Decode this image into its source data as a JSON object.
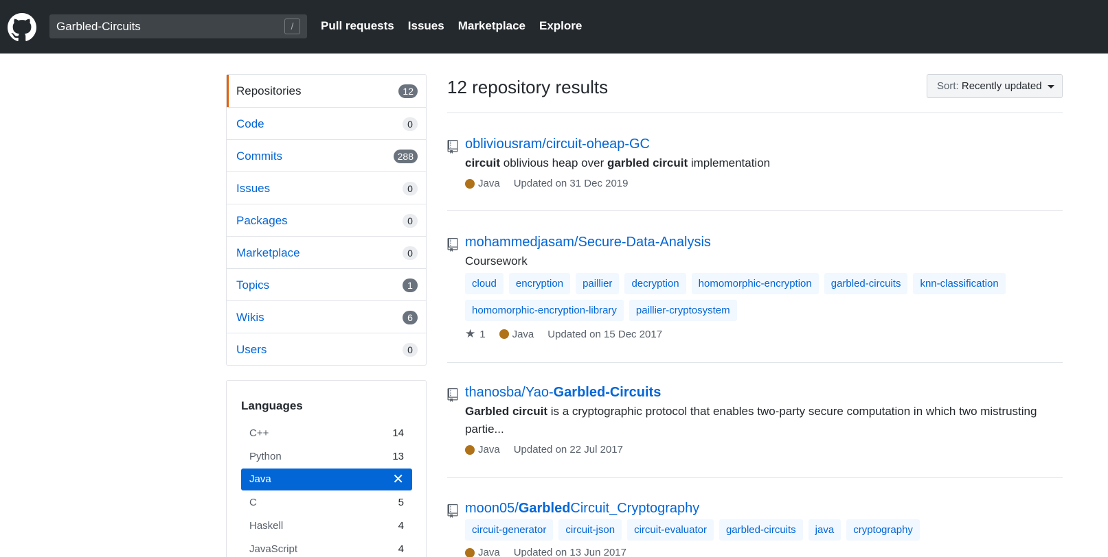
{
  "header": {
    "search_value": "Garbled-Circuits",
    "slash_key": "/",
    "nav": [
      "Pull requests",
      "Issues",
      "Marketplace",
      "Explore"
    ]
  },
  "menu": [
    {
      "label": "Repositories",
      "count": "12",
      "selected": true,
      "dark": true
    },
    {
      "label": "Code",
      "count": "0",
      "selected": false,
      "dark": false
    },
    {
      "label": "Commits",
      "count": "288",
      "selected": false,
      "dark": true
    },
    {
      "label": "Issues",
      "count": "0",
      "selected": false,
      "dark": false
    },
    {
      "label": "Packages",
      "count": "0",
      "selected": false,
      "dark": false
    },
    {
      "label": "Marketplace",
      "count": "0",
      "selected": false,
      "dark": false
    },
    {
      "label": "Topics",
      "count": "1",
      "selected": false,
      "dark": true
    },
    {
      "label": "Wikis",
      "count": "6",
      "selected": false,
      "dark": true
    },
    {
      "label": "Users",
      "count": "0",
      "selected": false,
      "dark": false
    }
  ],
  "languages": {
    "title": "Languages",
    "items": [
      {
        "name": "C++",
        "count": "14"
      },
      {
        "name": "Python",
        "count": "13"
      },
      {
        "name": "Java",
        "count": "✕",
        "active": true
      },
      {
        "name": "C",
        "count": "5"
      },
      {
        "name": "Haskell",
        "count": "4"
      },
      {
        "name": "JavaScript",
        "count": "4"
      }
    ]
  },
  "results": {
    "title": "12 repository results",
    "sort_label": "Sort:",
    "sort_value": "Recently updated"
  },
  "repos": [
    {
      "owner": "obliviousram/",
      "name_plain": "circuit-oheap-GC",
      "name_bold": "",
      "name_rest": "",
      "desc": [
        [
          "b",
          "circuit"
        ],
        [
          "t",
          " oblivious heap over "
        ],
        [
          "b",
          "garbled circuit"
        ],
        [
          "t",
          " implementation"
        ]
      ],
      "topics": [],
      "stars": "",
      "language": "Java",
      "updated": "Updated on 31 Dec 2019"
    },
    {
      "owner": "mohammedjasam/",
      "name_plain": "Secure-Data-Analysis",
      "name_bold": "",
      "name_rest": "",
      "desc": [
        [
          "t",
          "Coursework"
        ]
      ],
      "topics": [
        "cloud",
        "encryption",
        "paillier",
        "decryption",
        "homomorphic-encryption",
        "garbled-circuits",
        "knn-classification",
        "homomorphic-encryption-library",
        "paillier-cryptosystem"
      ],
      "stars": "1",
      "language": "Java",
      "updated": "Updated on 15 Dec 2017"
    },
    {
      "owner": "thanosba/",
      "name_plain": "Yao-",
      "name_bold": "Garbled-Circuits",
      "name_rest": "",
      "desc": [
        [
          "b",
          "Garbled circuit"
        ],
        [
          "t",
          " is a cryptographic protocol that enables two-party secure computation in which two mistrusting partie..."
        ]
      ],
      "topics": [],
      "stars": "",
      "language": "Java",
      "updated": "Updated on 22 Jul 2017"
    },
    {
      "owner": "moon05/",
      "name_plain": "",
      "name_bold": "Garbled",
      "name_rest": "Circuit_Cryptography",
      "desc": [],
      "topics": [
        "circuit-generator",
        "circuit-json",
        "circuit-evaluator",
        "garbled-circuits",
        "java",
        "cryptography"
      ],
      "stars": "",
      "language": "Java",
      "updated": "Updated on 13 Jun 2017"
    }
  ],
  "colors": {
    "header": "#24292e",
    "link": "#0366d6",
    "java": "#b07219",
    "selected_border": "#e36209"
  }
}
